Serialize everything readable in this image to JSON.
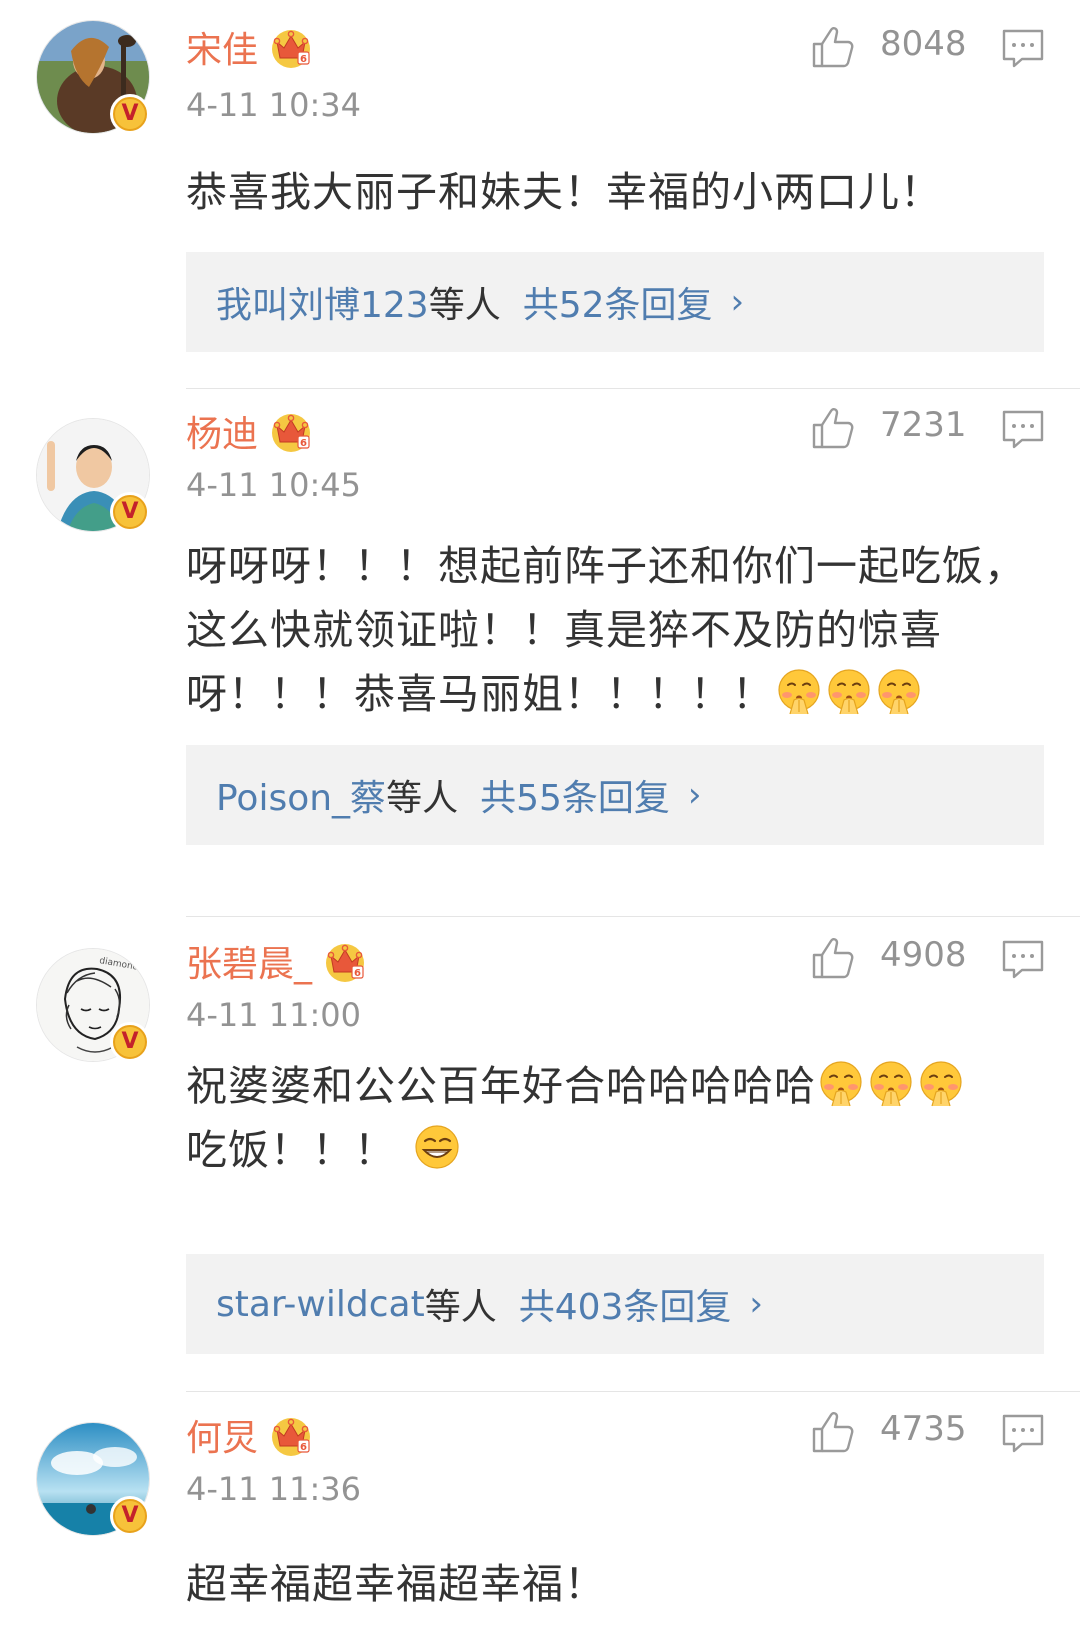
{
  "comments": [
    {
      "name": "宋佳",
      "time": "4-11 10:34",
      "likes": "8048",
      "text": "恭喜我大丽子和妹夫！幸福的小两口儿！",
      "reply_names": "我叫刘博123",
      "reply_suffix": "等人",
      "reply_count": "共52条回复",
      "verified_mark": "V",
      "avatar_icon": "avatar-photo"
    },
    {
      "name": "杨迪",
      "time": "4-11 10:45",
      "likes": "7231",
      "text": "呀呀呀！！！想起前阵子还和你们一起吃饭，这么快就领证啦！！真是猝不及防的惊喜呀！！！恭喜马丽姐！！！！！",
      "reply_names": "Poison_蔡",
      "reply_suffix": "等人",
      "reply_count": "共55条回复",
      "verified_mark": "V",
      "avatar_icon": "avatar-photo"
    },
    {
      "name": "张碧晨_",
      "time": "4-11 11:00",
      "likes": "4908",
      "text1": "祝婆婆和公公百年好合哈哈哈哈哈",
      "text2": "吃饭！！！",
      "reply_names": "star-wildcat",
      "reply_suffix": "等人",
      "reply_count": "共403条回复",
      "verified_mark": "V",
      "avatar_icon": "avatar-sketch"
    },
    {
      "name": "何炅",
      "time": "4-11 11:36",
      "likes": "4735",
      "text": "超幸福超幸福超幸福！",
      "verified_mark": "V",
      "avatar_icon": "avatar-photo"
    }
  ],
  "icons": {
    "like": "thumbs-up-icon",
    "reply": "comment-icon",
    "crown": "vip-crown-icon",
    "arrow": "chevron-right-icon"
  },
  "arrow_glyph": "›",
  "colors": {
    "name": "#eb7350",
    "link": "#507daf",
    "meta": "#939393",
    "text": "#333333",
    "reply_bg": "#f2f2f2"
  }
}
